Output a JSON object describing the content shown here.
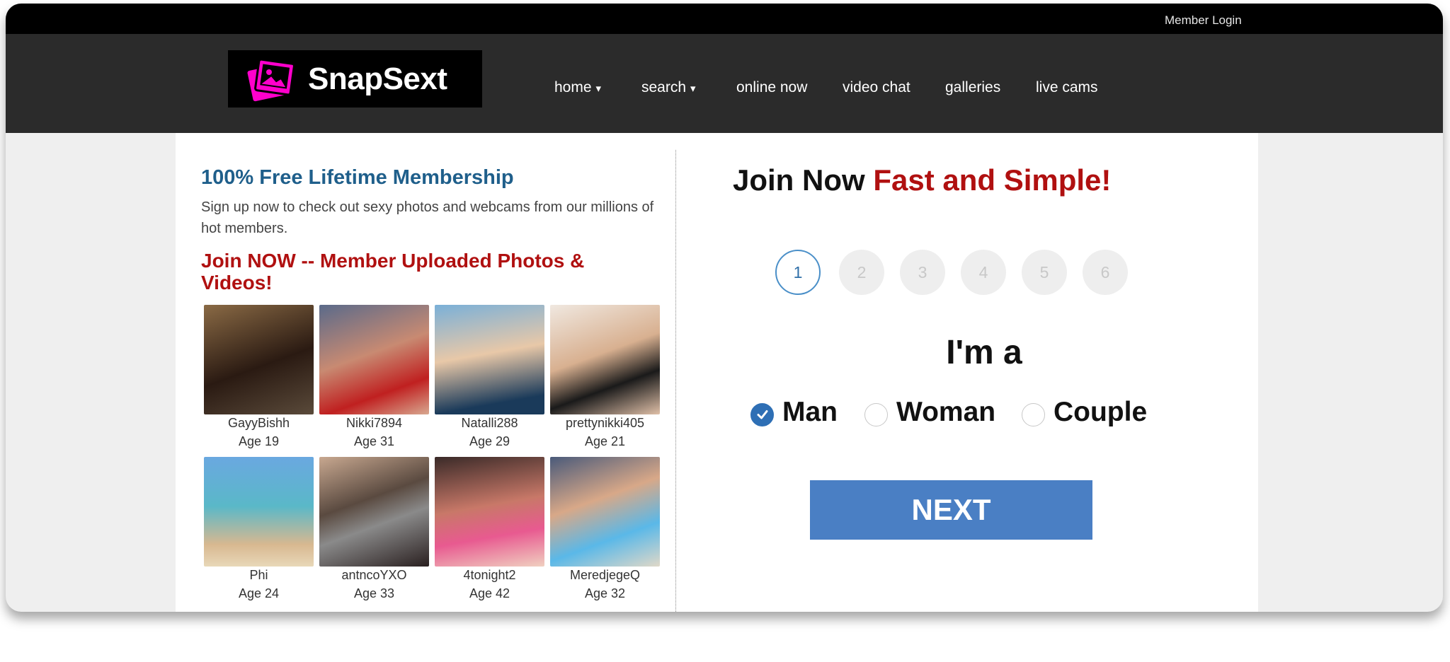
{
  "topbar": {
    "member_login": "Member Login"
  },
  "logo": {
    "text": "SnapSext",
    "icon": "photo-frames-icon",
    "color": "#ff00cc"
  },
  "nav": {
    "items": [
      {
        "label": "home",
        "has_caret": true
      },
      {
        "label": "search",
        "has_caret": true
      },
      {
        "label": "online now",
        "has_caret": false
      },
      {
        "label": "video chat",
        "has_caret": false
      },
      {
        "label": "galleries",
        "has_caret": false
      },
      {
        "label": "live cams",
        "has_caret": false
      }
    ],
    "caret": "▾"
  },
  "left": {
    "title": "100% Free Lifetime Membership",
    "subtitle": "Sign up now to check out sexy photos and webcams from our millions of hot members.",
    "join": "Join NOW -- Member Uploaded Photos & Videos!",
    "members": [
      {
        "name": "GayyBishh",
        "age": "Age 19"
      },
      {
        "name": "Nikki7894",
        "age": "Age 31"
      },
      {
        "name": "Natalli288",
        "age": "Age 29"
      },
      {
        "name": "prettynikki405",
        "age": "Age 21"
      },
      {
        "name": "Phi",
        "age": "Age 24"
      },
      {
        "name": "antncoYXO",
        "age": "Age 33"
      },
      {
        "name": "4tonight2",
        "age": "Age 42"
      },
      {
        "name": "MeredjegeQ",
        "age": "Age 32"
      }
    ]
  },
  "right": {
    "title_black": "Join Now",
    "title_red": "Fast and Simple!",
    "steps": [
      "1",
      "2",
      "3",
      "4",
      "5",
      "6"
    ],
    "active_step": "1",
    "im_a": "I'm a",
    "options": [
      {
        "label": "Man",
        "checked": true
      },
      {
        "label": "Woman",
        "checked": false
      },
      {
        "label": "Couple",
        "checked": false
      }
    ],
    "next_label": "NEXT"
  },
  "colors": {
    "accent_blue": "#4a7fc4",
    "title_blue": "#1f5f8b",
    "red": "#b01010",
    "nav_bg": "#2b2b2b"
  }
}
